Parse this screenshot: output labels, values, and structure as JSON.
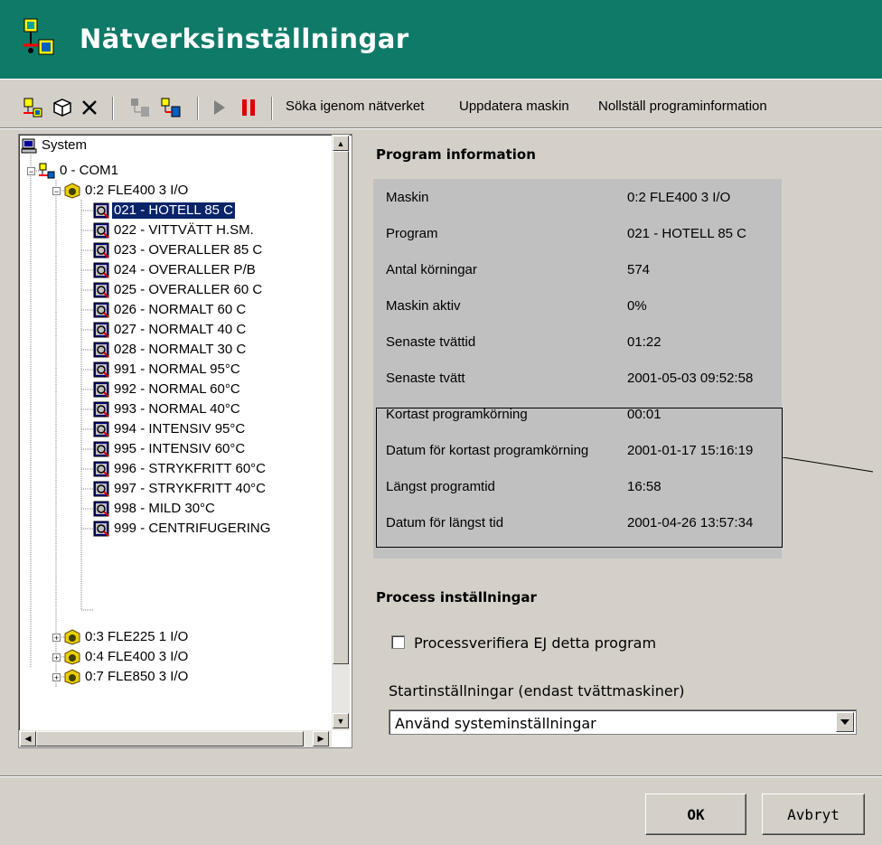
{
  "window": {
    "title": "Nätverksinställningar"
  },
  "toolbar": {
    "icons": [
      "network-add-icon",
      "cube-icon",
      "delete-icon",
      "machine-disabled-icon",
      "machine-network-icon",
      "play-icon",
      "pause-icon"
    ],
    "search_label": "Söka igenom nätverket",
    "update_label": "Uppdatera maskin",
    "reset_label": "Nollställ programinformation"
  },
  "tree": {
    "root": "System",
    "port": "0 - COM1",
    "machine_open": "0:2 FLE400 3 I/O",
    "programs": [
      "021 - HOTELL 85 C",
      "022 - VITTVÄTT H.SM.",
      "023 - OVERALLER 85 C",
      "024 - OVERALLER P/B",
      "025 - OVERALLER 60 C",
      "026 - NORMALT 60 C",
      "027 - NORMALT 40 C",
      "028 - NORMALT 30 C",
      "991 - NORMAL 95°C",
      "992 - NORMAL 60°C",
      "993 - NORMAL 40°C",
      "994 - INTENSIV 95°C",
      "995 - INTENSIV 60°C",
      "996 - STRYKFRITT 60°C",
      "997 - STRYKFRITT 40°C",
      "998 - MILD 30°C",
      "999 - CENTRIFUGERING"
    ],
    "machines_closed": [
      "0:3 FLE225 1 I/O",
      "0:4 FLE400 3 I/O",
      "0:7 FLE850 3 I/O"
    ]
  },
  "program_info": {
    "heading": "Program information",
    "rows": [
      {
        "label": "Maskin",
        "value": "0:2 FLE400 3 I/O"
      },
      {
        "label": "Program",
        "value": "021 - HOTELL 85 C"
      },
      {
        "label": "Antal körningar",
        "value": "574"
      },
      {
        "label": "Maskin aktiv",
        "value": "0%"
      },
      {
        "label": "Senaste tvättid",
        "value": "01:22"
      },
      {
        "label": "Senaste tvätt",
        "value": "2001-05-03 09:52:58"
      },
      {
        "label": "Kortast programkörning",
        "value": "00:01"
      },
      {
        "label": "Datum för kortast programkörning",
        "value": "2001-01-17 15:16:19"
      },
      {
        "label": "Längst programtid",
        "value": "16:58"
      },
      {
        "label": "Datum för längst tid",
        "value": "2001-04-26 13:57:34"
      }
    ]
  },
  "process": {
    "heading": "Process inställningar",
    "checkbox_label": "Processverifiera EJ detta program",
    "checkbox_checked": false,
    "start_label": "Startinställningar (endast tvättmaskiner)",
    "start_value": "Använd systeminställningar"
  },
  "buttons": {
    "ok": "OK",
    "cancel": "Avbryt"
  },
  "colors": {
    "titlebar": "#0f7a68",
    "selection": "#0a246a",
    "panel": "#c0c0c0"
  }
}
